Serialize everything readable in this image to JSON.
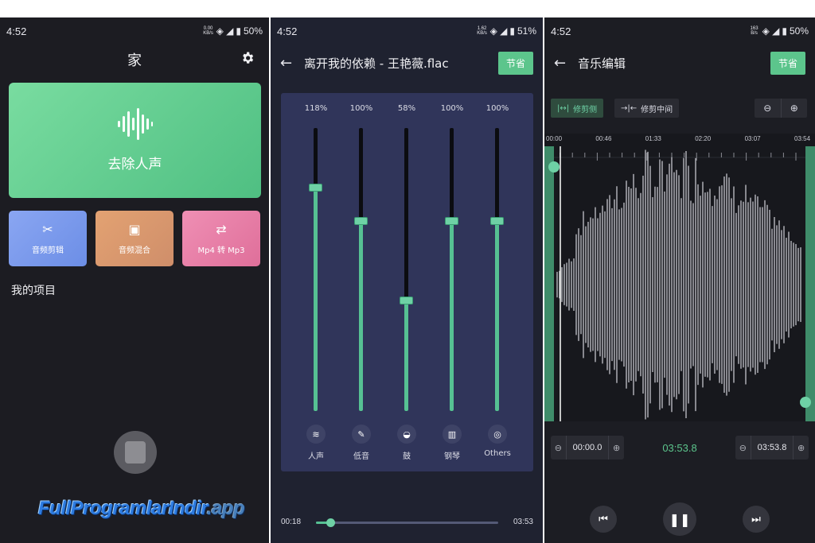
{
  "status": {
    "s1": {
      "time": "4:52",
      "speed": "0.00 KB/s",
      "battery": "50%"
    },
    "s2": {
      "time": "4:52",
      "speed": "1.62 KB/s",
      "battery": "51%"
    },
    "s3": {
      "time": "4:52",
      "speed": "163 B/s",
      "battery": "50%"
    }
  },
  "home": {
    "title": "家",
    "hero_label": "去除人声",
    "tiles": [
      {
        "label": "音频剪辑",
        "icon": "scissors-icon"
      },
      {
        "label": "音频混合",
        "icon": "mix-icon"
      },
      {
        "label": "Mp4 转 Mp3",
        "icon": "convert-icon"
      }
    ],
    "projects_title": "我的项目",
    "watermark": {
      "main": "FullProgramlarIndir",
      "suffix": ".app"
    }
  },
  "mixer": {
    "title": "离开我的依赖 - 王艳薇.flac",
    "save_label": "节省",
    "channels": [
      {
        "name": "人声",
        "percent": "118%",
        "level": 0.79,
        "icon": "waveform-icon"
      },
      {
        "name": "低音",
        "percent": "100%",
        "level": 0.67,
        "icon": "broom-icon"
      },
      {
        "name": "鼓",
        "percent": "58%",
        "level": 0.39,
        "icon": "drum-icon"
      },
      {
        "name": "钢琴",
        "percent": "100%",
        "level": 0.67,
        "icon": "piano-icon"
      },
      {
        "name": "Others",
        "percent": "100%",
        "level": 0.67,
        "icon": "target-icon"
      }
    ],
    "progress": {
      "current": "00:18",
      "duration": "03:53",
      "fraction": 0.08
    }
  },
  "editor": {
    "title": "音乐编辑",
    "save_label": "节省",
    "tool_trim_sides": "修剪侧",
    "tool_trim_middle": "修剪中间",
    "timeline": [
      "00:00",
      "00:46",
      "01:33",
      "02:20",
      "03:07",
      "03:54"
    ],
    "start_time": "00:00.0",
    "center_time": "03:53.8",
    "end_time": "03:53.8"
  },
  "colors": {
    "accent": "#5cc58c",
    "background": "#1c1c22",
    "mixer_panel": "#30355a"
  }
}
